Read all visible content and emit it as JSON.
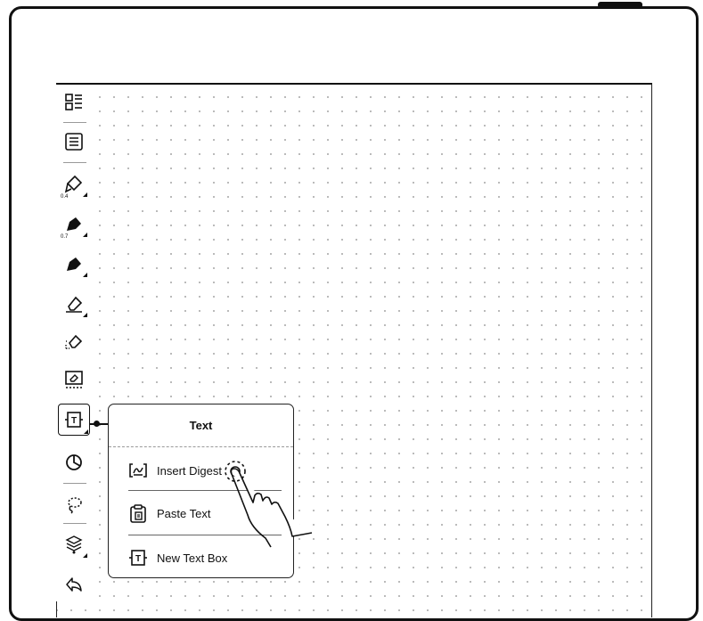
{
  "toolbar": {
    "items": [
      {
        "name": "layout",
        "icon": "thumbnail-list-icon"
      },
      {
        "name": "toc",
        "icon": "list-icon"
      },
      {
        "name": "pen-1",
        "icon": "fountain-pen-icon",
        "size": "0.4"
      },
      {
        "name": "pen-2",
        "icon": "marker-filled-icon",
        "size": "0.7"
      },
      {
        "name": "pen-3",
        "icon": "marker-filled-icon"
      },
      {
        "name": "eraser",
        "icon": "eraser-icon"
      },
      {
        "name": "stroke-eraser",
        "icon": "eraser-dotted-icon"
      },
      {
        "name": "area-eraser",
        "icon": "eraser-box-icon"
      },
      {
        "name": "text",
        "icon": "text-box-icon",
        "active": true
      },
      {
        "name": "shape",
        "icon": "pie-icon"
      },
      {
        "name": "lasso",
        "icon": "lasso-icon"
      },
      {
        "name": "layers",
        "icon": "layers-icon"
      },
      {
        "name": "undo",
        "icon": "undo-icon"
      }
    ]
  },
  "popup": {
    "title": "Text",
    "items": [
      {
        "label": "Insert Digest",
        "icon": "digest-icon"
      },
      {
        "label": "Paste Text",
        "icon": "clipboard-icon"
      },
      {
        "label": "New Text Box",
        "icon": "text-box-icon"
      }
    ]
  }
}
